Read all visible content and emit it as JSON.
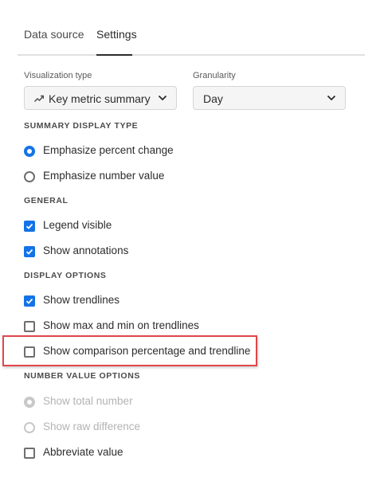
{
  "tabs": [
    {
      "label": "Data source",
      "selected": false
    },
    {
      "label": "Settings",
      "selected": true
    }
  ],
  "visualization_type": {
    "label": "Visualization type",
    "value": "Key metric summary",
    "icon": "trend-line-icon"
  },
  "granularity": {
    "label": "Granularity",
    "value": "Day"
  },
  "summary_display_type": {
    "heading": "SUMMARY DISPLAY TYPE",
    "options": [
      {
        "label": "Emphasize percent change",
        "checked": true
      },
      {
        "label": "Emphasize number value",
        "checked": false
      }
    ]
  },
  "general": {
    "heading": "GENERAL",
    "options": [
      {
        "label": "Legend visible",
        "checked": true
      },
      {
        "label": "Show annotations",
        "checked": true
      }
    ]
  },
  "display_options": {
    "heading": "DISPLAY OPTIONS",
    "options": [
      {
        "label": "Show trendlines",
        "checked": true
      },
      {
        "label": "Show max and min on trendlines",
        "checked": false
      },
      {
        "label": "Show comparison percentage and trendline",
        "checked": false,
        "highlighted": true
      }
    ]
  },
  "number_value_options": {
    "heading": "NUMBER VALUE OPTIONS",
    "options": [
      {
        "label": "Show total number",
        "checked": true,
        "disabled": true
      },
      {
        "label": "Show raw difference",
        "checked": false,
        "disabled": true
      },
      {
        "label": "Abbreviate value",
        "checked": false,
        "disabled": false
      }
    ]
  },
  "colors": {
    "accent": "#1473e6",
    "highlight": "#e0464b",
    "disabled": "#b3b3b3"
  }
}
